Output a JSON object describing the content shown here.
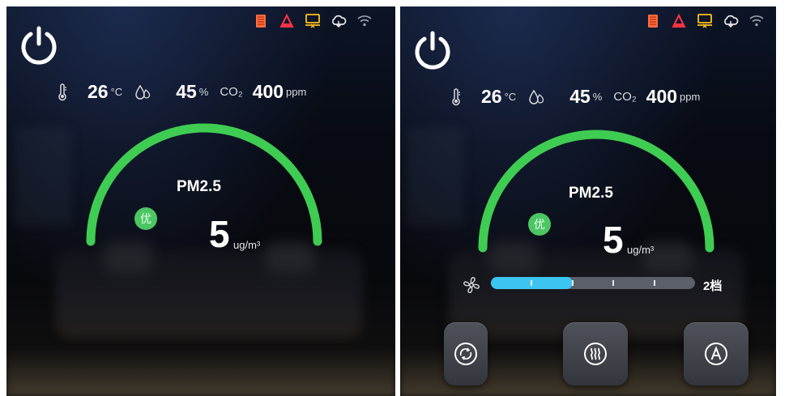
{
  "screens": [
    {
      "id": "left",
      "status_icons": [
        "filter-icon",
        "alert-icon",
        "display-off-icon",
        "cloud-icon",
        "wifi-icon"
      ],
      "power_icon": "power-icon",
      "sensors": {
        "temperature": {
          "value": "26",
          "unit": "°C"
        },
        "humidity": {
          "value": "45",
          "unit": "%"
        },
        "co2": {
          "label": "CO₂",
          "value": "400",
          "unit": "ppm"
        }
      },
      "pm25": {
        "title": "PM2.5",
        "value": "5",
        "unit": "ug/m³",
        "quality": "优"
      }
    },
    {
      "id": "right",
      "status_icons": [
        "filter-icon",
        "alert-icon",
        "display-off-icon",
        "cloud-icon",
        "wifi-icon"
      ],
      "power_icon": "power-icon",
      "sensors": {
        "temperature": {
          "value": "26",
          "unit": "°C"
        },
        "humidity": {
          "value": "45",
          "unit": "%"
        },
        "co2": {
          "label": "CO₂",
          "value": "400",
          "unit": "ppm"
        }
      },
      "pm25": {
        "title": "PM2.5",
        "value": "5",
        "unit": "ug/m³",
        "quality": "优"
      },
      "fan": {
        "level_label": "2档",
        "level": 2,
        "max_level": 5
      },
      "mode_buttons": [
        "cycle-mode-icon",
        "heat-mode-icon",
        "auto-mode-icon"
      ]
    }
  ],
  "colors": {
    "gauge_green": "#3fcc52",
    "fan_fill": "#3dc5f1",
    "filter_orange": "#ff6b3d",
    "alert_red": "#ff3344",
    "display_yellow": "#ffc21a"
  }
}
